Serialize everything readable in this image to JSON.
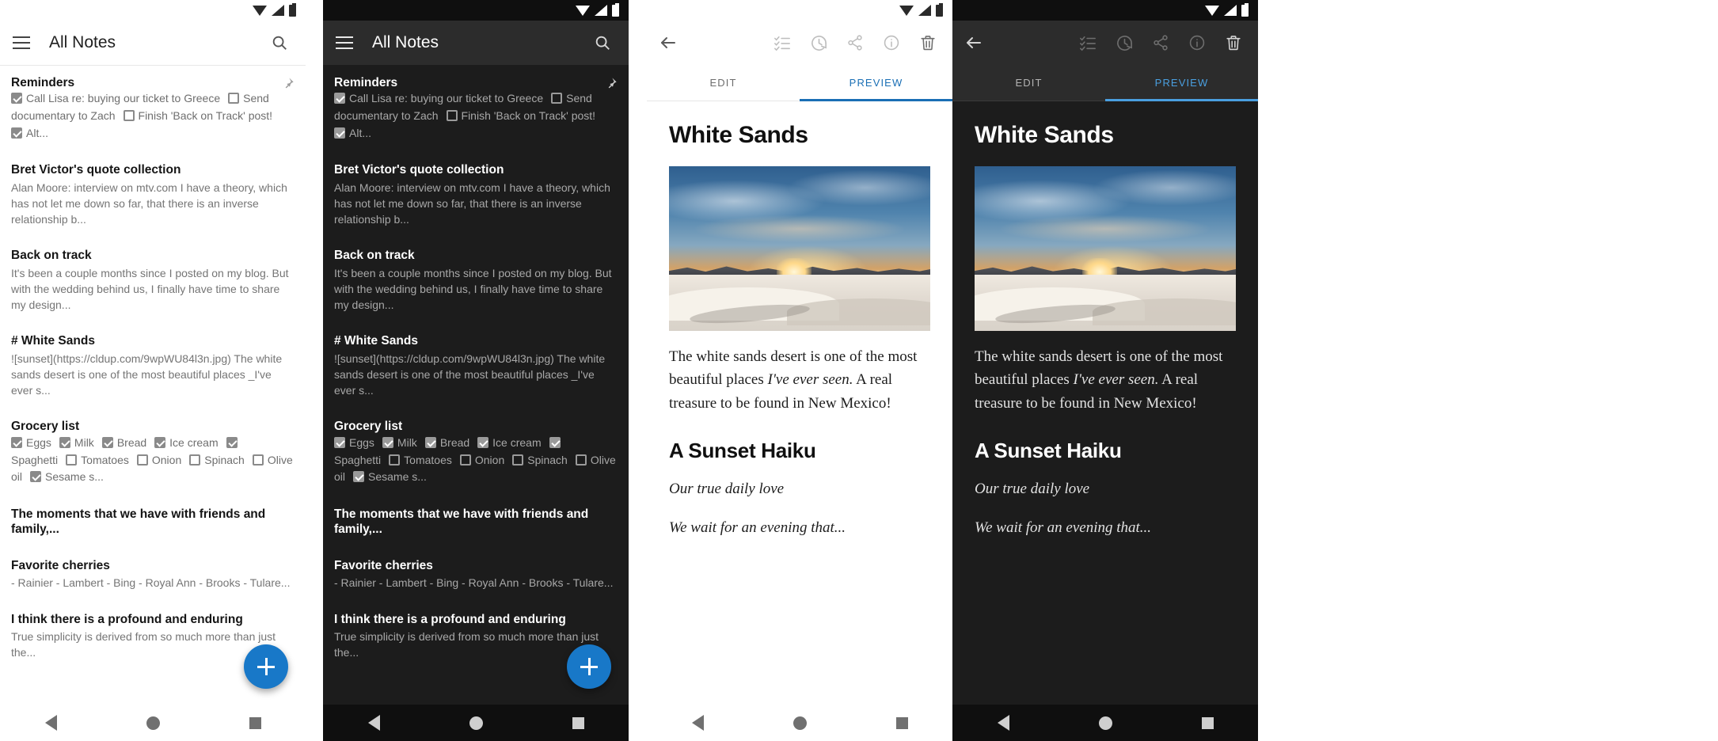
{
  "app": {
    "list_title": "All Notes",
    "fab_label": "+",
    "icons": {
      "menu": "hamburger-icon",
      "search": "search-icon",
      "back": "back-arrow-icon",
      "pin": "pin-icon",
      "checklist": "checklist-icon",
      "history": "history-icon",
      "share": "share-icon",
      "info": "info-icon",
      "delete": "trash-icon",
      "nav_back": "nav-back-triangle",
      "nav_home": "nav-home-circle",
      "nav_recents": "nav-recents-square"
    },
    "accent_light": "#1a6fb5",
    "accent_dark": "#4a9fe0",
    "fab_color": "#1878c8"
  },
  "notes": [
    {
      "title": "Reminders",
      "pinned": true,
      "type": "checklist",
      "items": [
        {
          "label": "Call Lisa re: buying our ticket to Greece",
          "checked": true
        },
        {
          "label": "Send documentary to Zach",
          "checked": false
        },
        {
          "label": "Finish 'Back on Track' post!",
          "checked": false
        },
        {
          "label": "Alt...",
          "checked": true
        }
      ]
    },
    {
      "title": "Bret Victor's quote collection",
      "pinned": false,
      "type": "text",
      "body": "Alan Moore: interview on mtv.com I have a theory, which has not let me down so far, that there is an inverse relationship b..."
    },
    {
      "title": "Back on track",
      "pinned": false,
      "type": "text",
      "body": "It's been a couple months since I posted on my blog. But with the wedding behind us, I finally have time to share my design..."
    },
    {
      "title": "# White Sands",
      "pinned": false,
      "type": "text",
      "body": "![sunset](https://cldup.com/9wpWU84l3n.jpg) The white sands desert is one of the most beautiful places _I've ever s..."
    },
    {
      "title": "Grocery list",
      "pinned": false,
      "type": "checklist",
      "items": [
        {
          "label": "Eggs",
          "checked": true
        },
        {
          "label": "Milk",
          "checked": true
        },
        {
          "label": "Bread",
          "checked": true
        },
        {
          "label": "Ice cream",
          "checked": true
        },
        {
          "label": "Spaghetti",
          "checked": true
        },
        {
          "label": "Tomatoes",
          "checked": false
        },
        {
          "label": "Onion",
          "checked": false
        },
        {
          "label": "Spinach",
          "checked": false
        },
        {
          "label": "Olive oil",
          "checked": false
        },
        {
          "label": "Sesame s...",
          "checked": true
        }
      ]
    },
    {
      "title": "The moments that we have with friends and family,...",
      "pinned": false,
      "type": "title-only",
      "body": ""
    },
    {
      "title": "Favorite cherries",
      "pinned": false,
      "type": "text",
      "body": "- Rainier  - Lambert  - Bing  - Royal Ann  - Brooks  - Tulare..."
    },
    {
      "title": "I think there is a profound and enduring",
      "pinned": false,
      "type": "text",
      "body": "True simplicity is derived from so much more than just the..."
    }
  ],
  "editor": {
    "tabs": [
      {
        "label": "EDIT",
        "selected": false
      },
      {
        "label": "PREVIEW",
        "selected": true
      }
    ],
    "document": {
      "heading": "White Sands",
      "image_alt": "sunset",
      "paragraph_1_a": "The white sands desert is one of the most beautiful places ",
      "paragraph_1_em": "I've ever seen.",
      "paragraph_1_b": " A real treasure to be found in New Mexico!",
      "heading_2": "A Sunset Haiku",
      "haiku_line_1": "Our true daily love",
      "haiku_line_2": "We wait for an evening that..."
    }
  }
}
